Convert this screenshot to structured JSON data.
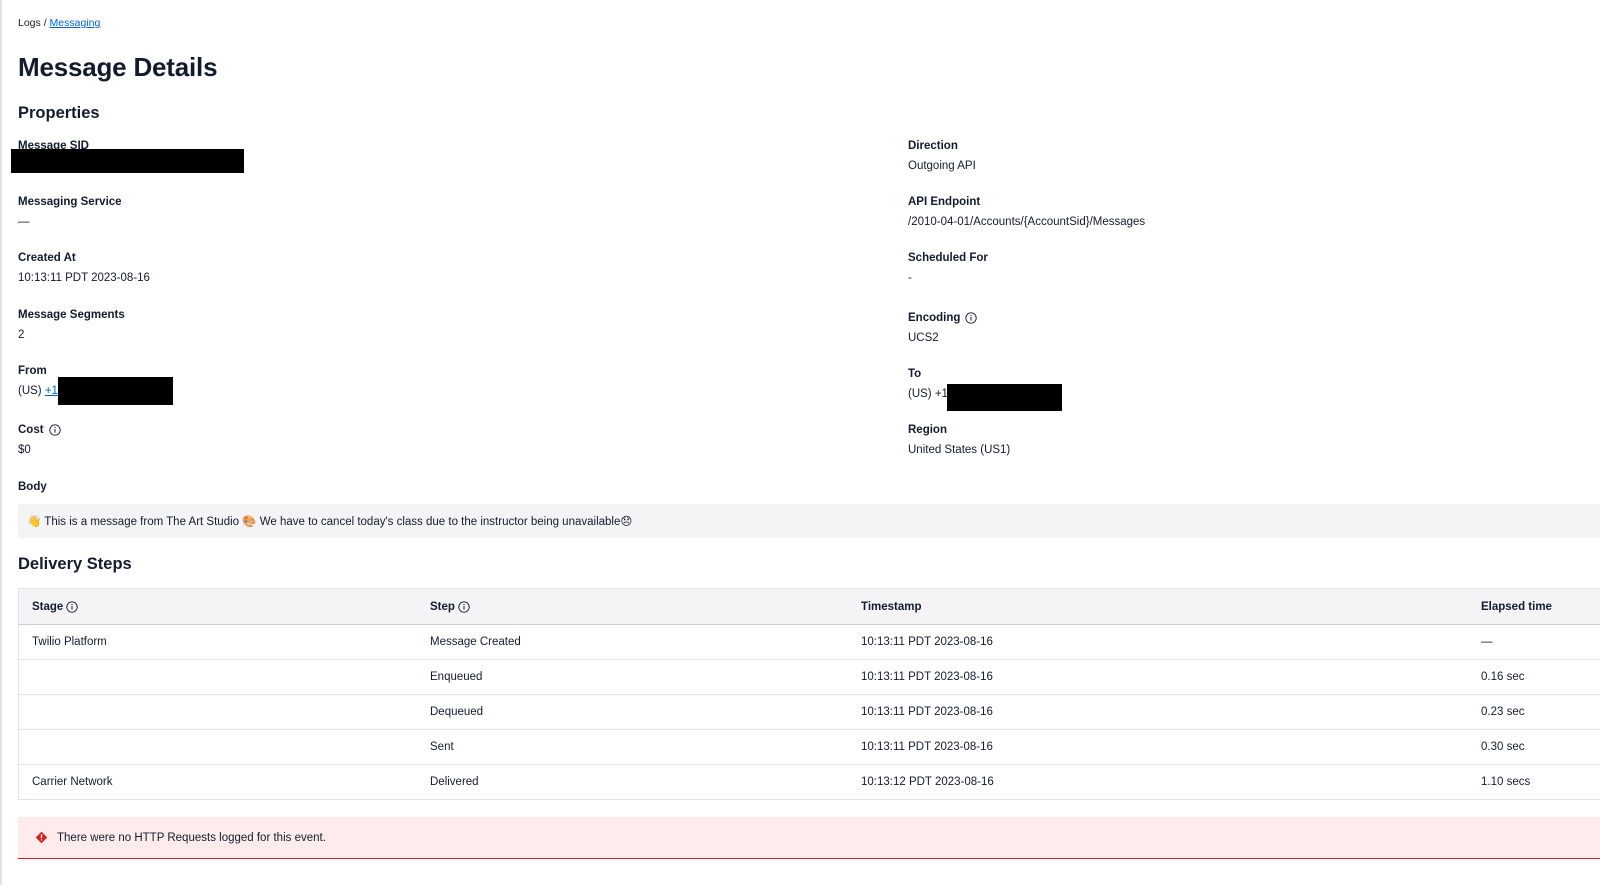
{
  "breadcrumb": {
    "root": "Logs",
    "separator": "/",
    "current": "Messaging"
  },
  "page": {
    "title": "Message Details"
  },
  "properties": {
    "title": "Properties",
    "left": {
      "message_sid": {
        "label": "Message SID",
        "value": ""
      },
      "messaging_service": {
        "label": "Messaging Service",
        "value": "—"
      },
      "created_at": {
        "label": "Created At",
        "value": "10:13:11 PDT 2023-08-16"
      },
      "message_segments": {
        "label": "Message Segments",
        "value": "2"
      },
      "from": {
        "label": "From",
        "prefix": "(US)",
        "link": "+1"
      },
      "cost": {
        "label": "Cost",
        "value": "$0"
      }
    },
    "right": {
      "direction": {
        "label": "Direction",
        "value": "Outgoing API"
      },
      "api_endpoint": {
        "label": "API Endpoint",
        "value": "/2010-04-01/Accounts/{AccountSid}/Messages"
      },
      "scheduled_for": {
        "label": "Scheduled For",
        "value": "-"
      },
      "encoding": {
        "label": "Encoding",
        "value": "UCS2"
      },
      "to": {
        "label": "To",
        "value": "(US) +1"
      },
      "region": {
        "label": "Region",
        "value": "United States (US1)"
      }
    },
    "body": {
      "label": "Body",
      "value": "👋 This is a message from The Art Studio 🎨 We have to cancel today's class due to the instructor being unavailable😞"
    }
  },
  "delivery": {
    "title": "Delivery Steps",
    "headers": {
      "stage": "Stage",
      "step": "Step",
      "timestamp": "Timestamp",
      "elapsed": "Elapsed time"
    },
    "rows": [
      {
        "stage": "Twilio Platform",
        "step": "Message Created",
        "timestamp": "10:13:11 PDT 2023-08-16",
        "elapsed": "—"
      },
      {
        "stage": "",
        "step": "Enqueued",
        "timestamp": "10:13:11 PDT 2023-08-16",
        "elapsed": "0.16 sec"
      },
      {
        "stage": "",
        "step": "Dequeued",
        "timestamp": "10:13:11 PDT 2023-08-16",
        "elapsed": "0.23 sec"
      },
      {
        "stage": "",
        "step": "Sent",
        "timestamp": "10:13:11 PDT 2023-08-16",
        "elapsed": "0.30 sec"
      },
      {
        "stage": "Carrier Network",
        "step": "Delivered",
        "timestamp": "10:13:12 PDT 2023-08-16",
        "elapsed": "1.10 secs"
      }
    ]
  },
  "alert": {
    "message": "There were no HTTP Requests logged for this event.",
    "icon": "error-diamond-icon",
    "color": "#d61f1f"
  },
  "icons": {
    "info": "info-icon"
  },
  "colors": {
    "link": "#0263e0",
    "text": "#121c2d",
    "surface": "#f4f4f6",
    "error_bg": "#feeced"
  }
}
